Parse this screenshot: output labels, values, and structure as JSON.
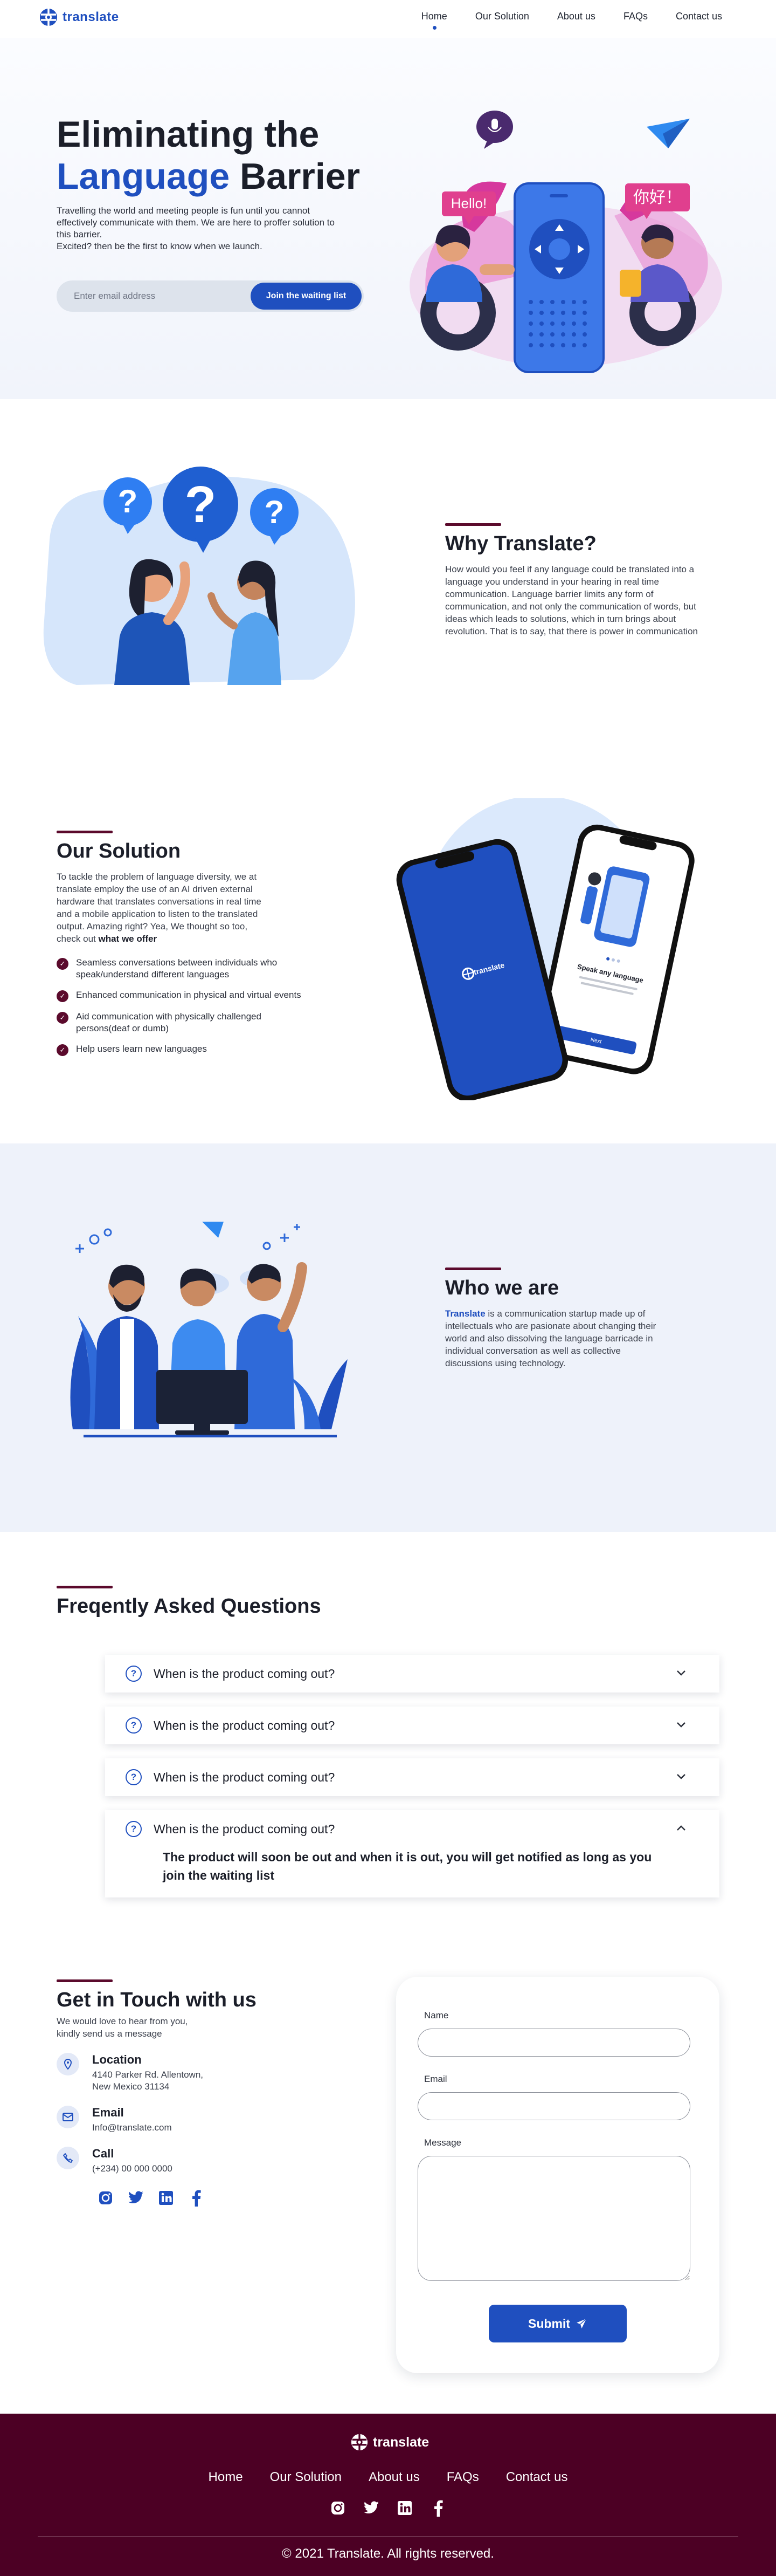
{
  "brand": {
    "name": "translate",
    "color_primary": "#1f4fbf",
    "color_accent": "#5b0a2c",
    "color_footer": "#4c0024"
  },
  "nav": {
    "items": [
      {
        "label": "Home",
        "active": true
      },
      {
        "label": "Our Solution",
        "active": false
      },
      {
        "label": "About us",
        "active": false
      },
      {
        "label": "FAQs",
        "active": false
      },
      {
        "label": "Contact us",
        "active": false
      }
    ]
  },
  "hero": {
    "title_line1": "Eliminating the",
    "title_word_blue": "Language",
    "title_word_dark": "Barrier",
    "text_line1": "Travelling the world and meeting people is fun until you cannot effectively communicate with them. We are here to proffer solution to this barrier.",
    "text_line2": "Excited? then be the first to know when we launch.",
    "email_placeholder": "Enter email address",
    "button_label": "Join the waiting list",
    "bubble_left": "Hello!",
    "bubble_right": "你好！"
  },
  "why": {
    "title": "Why Translate?",
    "body": "How would you feel if any language could be translated into a language you understand in your hearing in real time communication. Language barrier limits any form of communication, and not only the communication of words, but ideas which leads to solutions, which in turn brings about revolution. That is to say, that there is power in communication"
  },
  "solution": {
    "title": "Our Solution",
    "body": "To tackle the problem of language diversity, we at translate employ the use of an AI driven external hardware that translates conversations in real time and a mobile application to listen to the translated output. Amazing right? Yea, We thought so too, check out",
    "body_bold": "what we offer",
    "checklist": [
      "Seamless conversations between individuals who speak/understand different languages",
      "Enhanced communication in physical and virtual events",
      "Aid communication with physically challenged persons(deaf or dumb)",
      "Help users learn new languages"
    ],
    "phone_logo": "translate",
    "phone_heading": "Speak any language",
    "phone_button": "Next"
  },
  "who": {
    "title": "Who we are",
    "body_bold": "Translate",
    "body": "is a communication startup made up of intellectuals who are pasionate about changing their world and also dissolving the language barricade in individual conversation as well as collective discussions using technology."
  },
  "faq": {
    "title": "Freqently Asked Questions",
    "items": [
      {
        "question": "When is the product coming out?",
        "open": false
      },
      {
        "question": "When is the product coming out?",
        "open": false
      },
      {
        "question": "When is the product coming out?",
        "open": false
      },
      {
        "question": "When is the product coming out?",
        "open": true,
        "answer": "The product will soon be out and when it is out, you will get notified as long as you join the waiting list"
      }
    ]
  },
  "contact": {
    "title": "Get in Touch with us",
    "subtitle": "We would love to hear from you, kindly send us a message",
    "location_label": "Location",
    "location_value": "4140 Parker Rd. Allentown, New Mexico 31134",
    "email_label": "Email",
    "email_value": "Info@translate.com",
    "call_label": "Call",
    "call_value": "(+234) 00 000 0000",
    "form": {
      "name_label": "Name",
      "email_label": "Email",
      "message_label": "Message",
      "submit_label": "Submit"
    }
  },
  "footer": {
    "logo_text": "translate",
    "links": [
      "Home",
      "Our Solution",
      "About us",
      "FAQs",
      "Contact us"
    ],
    "copyright": "2021 Translate. All rights reserved."
  }
}
